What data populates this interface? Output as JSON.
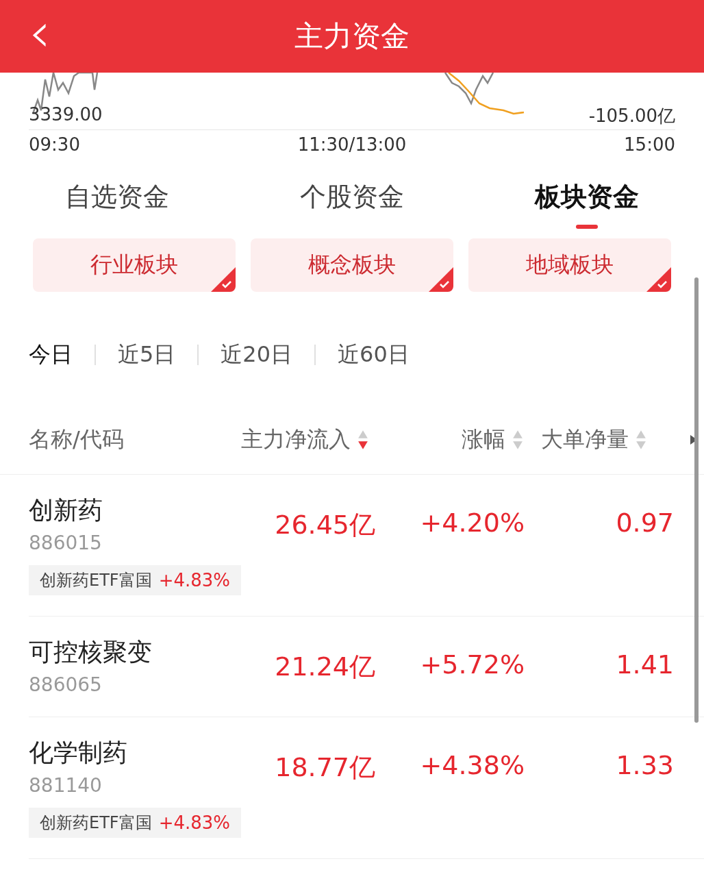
{
  "header": {
    "back_icon": "‹",
    "title": "主力资金"
  },
  "chart": {
    "left_value": "3339.00",
    "right_value": "-105.00亿",
    "times": [
      "09:30",
      "11:30/13:00",
      "15:00"
    ]
  },
  "tabs": [
    {
      "label": "自选资金",
      "selected": false
    },
    {
      "label": "个股资金",
      "selected": false
    },
    {
      "label": "板块资金",
      "selected": true
    }
  ],
  "filters": [
    {
      "label": "行业板块",
      "selected": true
    },
    {
      "label": "概念板块",
      "selected": true
    },
    {
      "label": "地域板块",
      "selected": true
    }
  ],
  "periods": [
    {
      "label": "今日",
      "selected": true
    },
    {
      "label": "近5日",
      "selected": false
    },
    {
      "label": "近20日",
      "selected": false
    },
    {
      "label": "近60日",
      "selected": false
    }
  ],
  "columns": [
    {
      "label": "名称/代码",
      "kind": "plain"
    },
    {
      "label": "主力净流入",
      "kind": "sortable",
      "sorted_desc": true
    },
    {
      "label": "涨幅",
      "kind": "sortable",
      "sorted_desc": false
    },
    {
      "label": "大单净量",
      "kind": "sortable",
      "sorted_desc": false
    }
  ],
  "rows": [
    {
      "name": "创新药",
      "code": "886015",
      "inflow": "26.45亿",
      "change": "+4.20%",
      "big_order": "0.97",
      "tag": {
        "name": "创新药ETF富国",
        "change": "+4.83%"
      }
    },
    {
      "name": "可控核聚变",
      "code": "886065",
      "inflow": "21.24亿",
      "change": "+5.72%",
      "big_order": "1.41"
    },
    {
      "name": "化学制药",
      "code": "881140",
      "inflow": "18.77亿",
      "change": "+4.38%",
      "big_order": "1.33",
      "tag": {
        "name": "创新药ETF富国",
        "change": "+4.83%"
      }
    }
  ]
}
